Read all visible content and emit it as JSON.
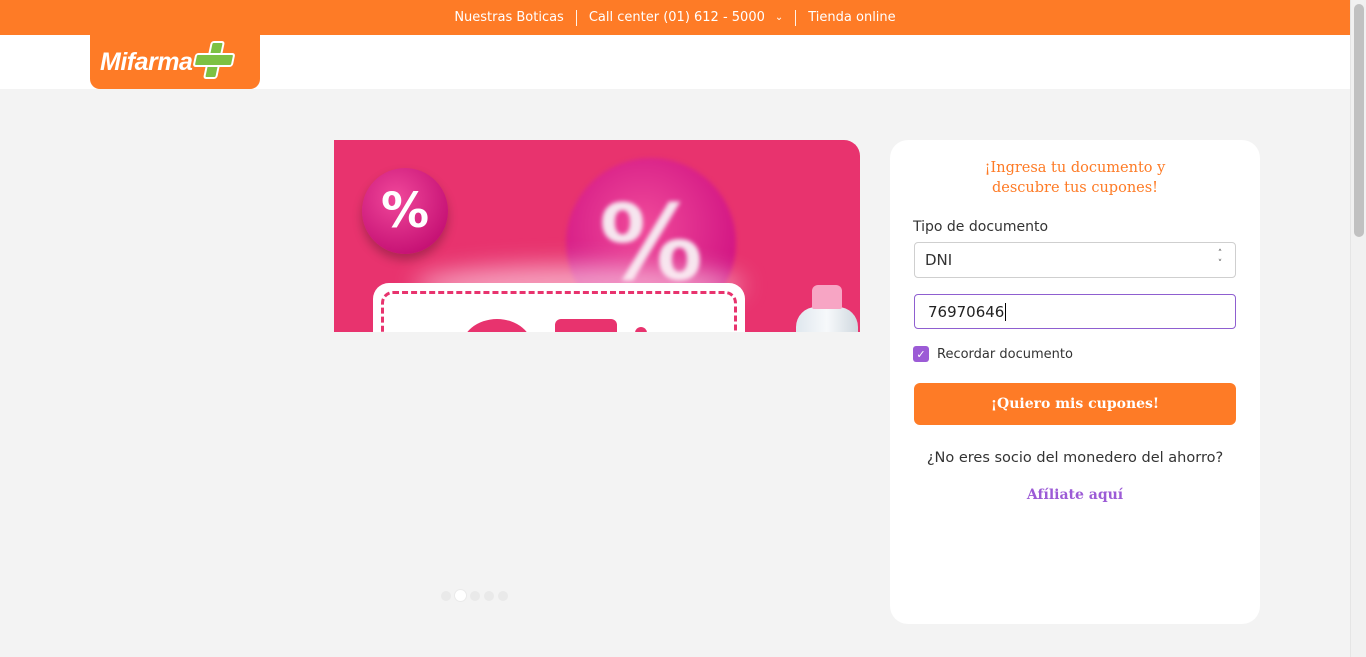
{
  "topbar": {
    "links": [
      "Nuestras Boticas",
      "Call center (01) 612 - 5000",
      "Tienda online"
    ]
  },
  "brand": {
    "name": "Mifarma",
    "primary_color": "#fe7b26",
    "accent_color": "#7dc142",
    "purple": "#9c5bd6"
  },
  "banner": {
    "percent_symbol": "%",
    "slides_count": 5,
    "active_slide": 2
  },
  "form": {
    "title_line1": "¡Ingresa tu documento y",
    "title_line2": "descubre tus cupones!",
    "doc_type_label": "Tipo de documento",
    "doc_type_value": "DNI",
    "doc_number_value": "76970646",
    "remember_label": "Recordar documento",
    "remember_checked": true,
    "submit_label": "¡Quiero mis cupones!",
    "not_member_text": "¿No eres socio del monedero del ahorro?",
    "affiliate_link": "Afíliate aquí"
  }
}
